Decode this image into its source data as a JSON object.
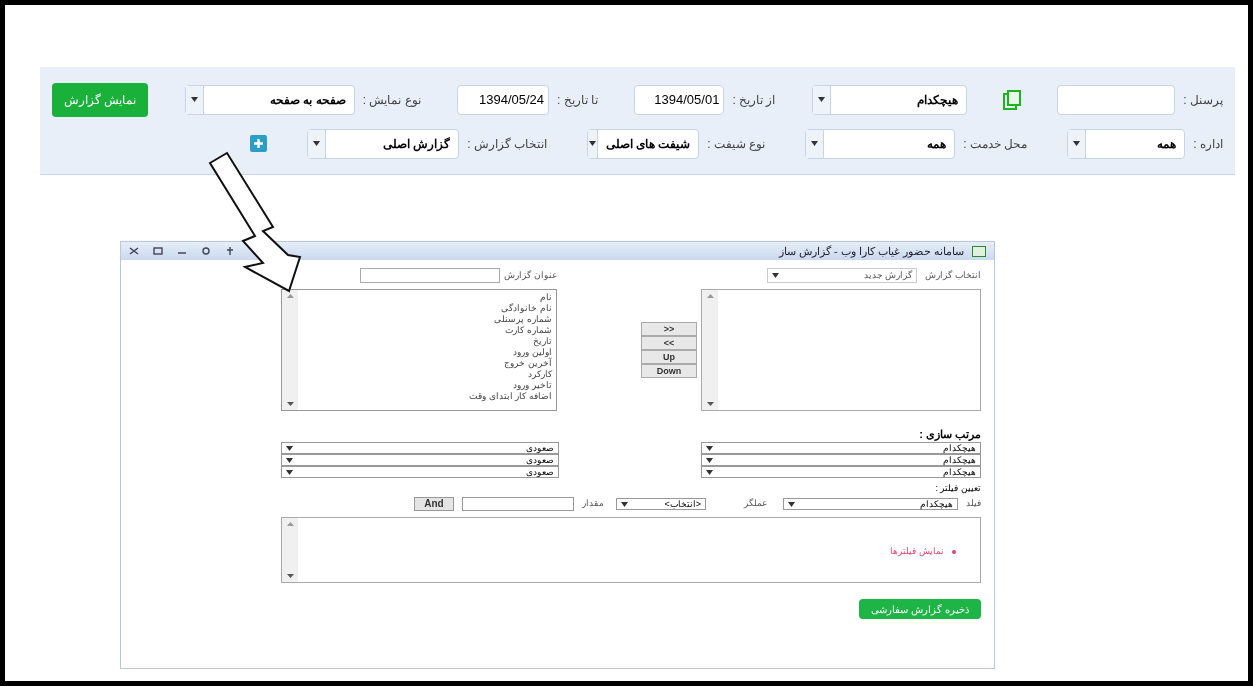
{
  "toolbar": {
    "first_row": [
      {
        "kind": "input",
        "label": "پرسنل :"
      },
      {
        "kind": "icon"
      },
      {
        "kind": "select",
        "value": "هیچکدام"
      },
      {
        "kind": "input",
        "label": "از تاریخ :",
        "value": "1394/05/01"
      },
      {
        "kind": "input",
        "label": "تا تاریخ :",
        "value": "1394/05/24"
      },
      {
        "kind": "select",
        "label": "نوع نمایش :",
        "value": "صفحه به صفحه"
      },
      {
        "kind": "button",
        "label": "نمایش گزارش"
      }
    ],
    "second_row": [
      {
        "kind": "select",
        "label": "اداره :",
        "value": "همه"
      },
      {
        "kind": "select",
        "label": "محل خدمت :",
        "value": "همه"
      },
      {
        "kind": "select",
        "label": "نوع شیفت :",
        "value": "شیفت های اصلی"
      },
      {
        "kind": "select",
        "label": "انتخاب گزارش :",
        "value": "گزارش اصلی"
      },
      {
        "kind": "add"
      }
    ]
  },
  "dialog": {
    "title": "سامانه حضور غیاب کارا وب - گزارش ساز",
    "report_select": {
      "label": "انتخاب گزارش",
      "value": "گزارش جدید"
    },
    "report_title": {
      "label": "عنوان گزارش"
    },
    "available_fields": [
      "نام",
      "نام خانوادگی",
      "شماره پرسنلی",
      "شماره کارت",
      "تاریخ",
      "اولین ورود",
      "آخرین خروج",
      "کارکرد",
      "تاخیر ورود",
      "اضافه کار ابتدای وقت"
    ],
    "move_buttons": [
      ">>",
      "<<",
      "Up",
      "Down"
    ],
    "sort": {
      "label": "مرتب سازی :",
      "fields": [
        "هیچکدام",
        "هیچکدام",
        "هیچکدام"
      ],
      "orders": [
        "صعودی",
        "صعودی",
        "صعودی"
      ]
    },
    "filter": {
      "label": "تعیین فیلتر :",
      "field": {
        "label": "فیلد",
        "value": "هیچکدام"
      },
      "operator": {
        "label": "عملگر",
        "value": "<انتخاب>"
      },
      "value": {
        "label": "مقدار"
      },
      "and_button": "And",
      "list_heading": "نمایش فیلترها"
    },
    "save_button": "ذخیره گزارش سفارشی"
  }
}
